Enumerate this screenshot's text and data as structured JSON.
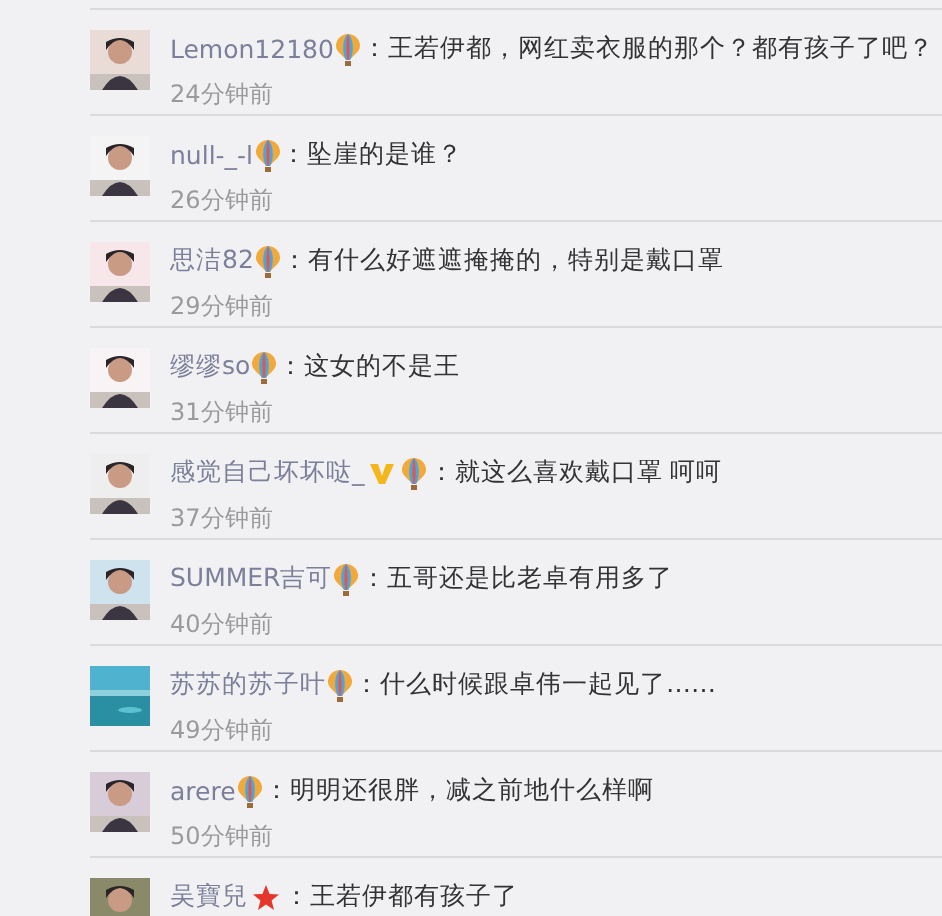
{
  "comments": [
    {
      "user": "Lemon12180",
      "badges": [
        {
          "kind": "balloon"
        }
      ],
      "text": "：王若伊都，网红卖衣服的那个？都有孩子了吧？",
      "time": "24分钟前"
    },
    {
      "user": "null-_-l",
      "badges": [
        {
          "kind": "balloon"
        }
      ],
      "text": "：坠崖的是谁？",
      "time": "26分钟前"
    },
    {
      "user": "思洁82",
      "badges": [
        {
          "kind": "balloon"
        }
      ],
      "text": "：有什么好遮遮掩掩的，特别是戴口罩",
      "time": "29分钟前"
    },
    {
      "user": "缪缪so",
      "badges": [
        {
          "kind": "balloon"
        }
      ],
      "text": "：这女的不是王",
      "time": "31分钟前"
    },
    {
      "user": "感觉自己坏坏哒_",
      "badges": [
        {
          "kind": "vip"
        },
        {
          "kind": "balloon"
        }
      ],
      "text": "：就这么喜欢戴口罩 呵呵",
      "time": "37分钟前"
    },
    {
      "user": "SUMMER吉可",
      "badges": [
        {
          "kind": "balloon"
        }
      ],
      "text": "：五哥还是比老卓有用多了",
      "time": "40分钟前"
    },
    {
      "user": "苏苏的苏子叶",
      "badges": [
        {
          "kind": "balloon"
        }
      ],
      "text": "：什么时候跟卓伟一起见了……",
      "time": "49分钟前"
    },
    {
      "user": "arere",
      "badges": [
        {
          "kind": "balloon"
        }
      ],
      "text": "：明明还很胖，减之前地什么样啊",
      "time": "50分钟前"
    },
    {
      "user": "吴寶兒",
      "badges": [
        {
          "kind": "star"
        }
      ],
      "text": "：王若伊都有孩子了"
    }
  ]
}
